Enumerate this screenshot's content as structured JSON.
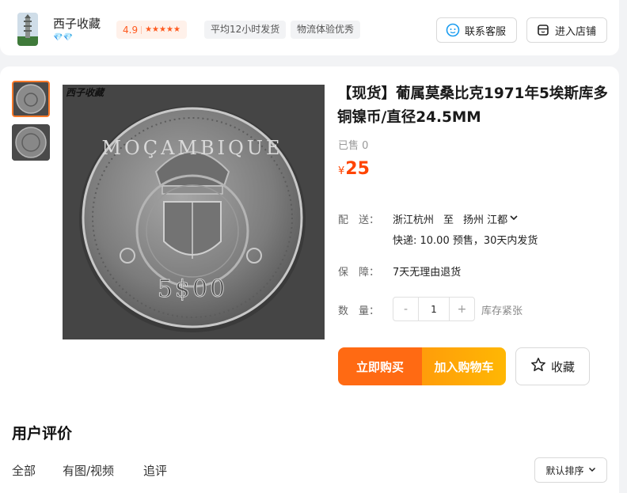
{
  "shop": {
    "name": "西子收藏",
    "rating": "4.9",
    "stars": "★★★★★",
    "diamonds": "💎💎",
    "tags": [
      "平均12小时发货",
      "物流体验优秀"
    ],
    "contact_label": "联系客服",
    "enter_label": "进入店铺"
  },
  "product": {
    "title": "【现货】葡属莫桑比克1971年5埃斯库多铜镍币/直径24.5MM",
    "sold": "已售 0",
    "currency": "¥",
    "price": "25",
    "image_watermark": "西子收藏",
    "coin_legend": "MOÇAMBIQUE",
    "coin_value": "5$00"
  },
  "delivery": {
    "label_a": "配",
    "label_b": "送：",
    "from": "浙江杭州",
    "to_word": "至",
    "to": "扬州 江都",
    "shipping": "快递: 10.00  预售，30天内发货"
  },
  "guarantee": {
    "label_a": "保",
    "label_b": "障：",
    "text": "7天无理由退货"
  },
  "quantity": {
    "label_a": "数",
    "label_b": "量：",
    "minus": "-",
    "value": "1",
    "plus": "+",
    "stock": "库存紧张"
  },
  "actions": {
    "buy_now": "立即购买",
    "add_cart": "加入购物车",
    "favorite": "收藏"
  },
  "reviews": {
    "title": "用户评价",
    "tabs": [
      "全部",
      "有图/视频",
      "追评"
    ],
    "sort": "默认排序"
  },
  "colors": {
    "accent": "#ff6a13",
    "price": "#ff4400",
    "cart": "#ffb703"
  }
}
